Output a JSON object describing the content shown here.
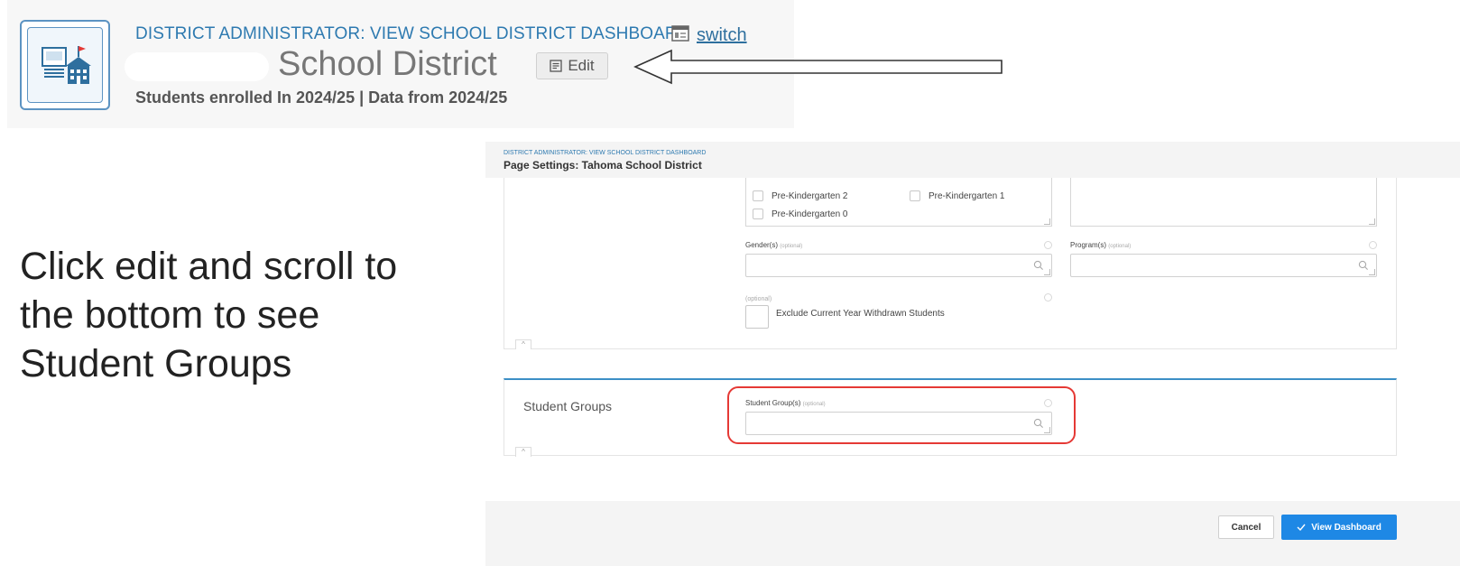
{
  "header": {
    "role_label": "DISTRICT ADMINISTRATOR: VIEW SCHOOL DISTRICT DASHBOARD",
    "switch_label": "switch",
    "district_name": "School District",
    "edit_label": "Edit",
    "enrollment_text": "Students enrolled In 2024/25 | Data from 2024/25"
  },
  "instruction": {
    "text": "Click edit and scroll to the bottom to see Student Groups"
  },
  "settings": {
    "breadcrumb": "DISTRICT ADMINISTRATOR: VIEW SCHOOL DISTRICT DASHBOARD",
    "title": "Page Settings: Tahoma School District",
    "grade_options": [
      {
        "label": "Pre-Kindergarten 2"
      },
      {
        "label": "Pre-Kindergarten 1"
      },
      {
        "label": "Pre-Kindergarten 0"
      }
    ],
    "gender_field": {
      "label": "Gender(s)",
      "optional": "(optional)"
    },
    "program_field": {
      "label": "Program(s)",
      "optional": "(optional)"
    },
    "exclude_field": {
      "optional": "(optional)",
      "label": "Exclude Current Year Withdrawn Students"
    },
    "student_groups": {
      "section_title": "Student Groups",
      "field_label": "Student Group(s)",
      "optional": "(optional)"
    },
    "footer": {
      "cancel_label": "Cancel",
      "view_label": "View Dashboard"
    }
  },
  "colors": {
    "accent": "#1e88e5",
    "link": "#2e7ab0",
    "highlight": "#e53935"
  }
}
